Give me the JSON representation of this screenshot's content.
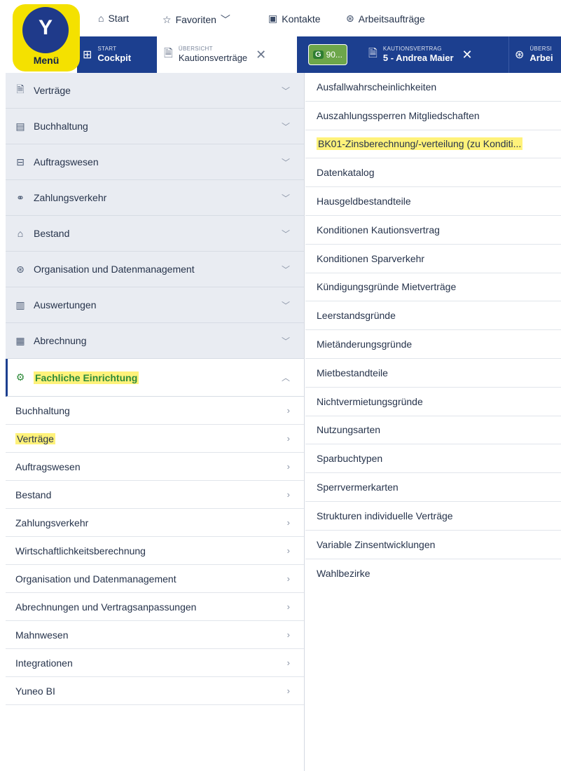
{
  "app": {
    "logo_letter": "Y",
    "menu_label": "Menü"
  },
  "topnav": [
    {
      "icon": "home-icon",
      "label": "Start"
    },
    {
      "icon": "star-icon",
      "label": "Favoriten"
    },
    {
      "icon": "contacts-icon",
      "label": "Kontakte"
    },
    {
      "icon": "tasks-icon",
      "label": "Arbeitsaufträge"
    }
  ],
  "tabs": [
    {
      "small": "START",
      "big": "Cockpit"
    },
    {
      "small": "ÜBERSICHT",
      "big": "Kautionsverträge",
      "active": true
    },
    {
      "badge_letter": "G",
      "badge_text": "90..."
    },
    {
      "small": "KAUTIONSVERTRAG",
      "big": "5 - Andrea Maier"
    },
    {
      "small": "ÜBERSI",
      "big": "Arbei"
    }
  ],
  "accordion": [
    {
      "icon": "contract-icon",
      "label": "Verträge"
    },
    {
      "icon": "ledger-icon",
      "label": "Buchhaltung"
    },
    {
      "icon": "order-icon",
      "label": "Auftragswesen"
    },
    {
      "icon": "payment-icon",
      "label": "Zahlungsverkehr"
    },
    {
      "icon": "building-icon",
      "label": "Bestand"
    },
    {
      "icon": "organization-icon",
      "label": "Organisation und Datenmanagement"
    },
    {
      "icon": "chart-icon",
      "label": "Auswertungen"
    },
    {
      "icon": "billing-icon",
      "label": "Abrechnung"
    },
    {
      "icon": "gear-icon",
      "label": "Fachliche Einrichtung"
    }
  ],
  "sub_items": [
    "Buchhaltung",
    "Verträge",
    "Auftragswesen",
    "Bestand",
    "Zahlungsverkehr",
    "Wirtschaftlichkeitsberechnung",
    "Organisation und Datenmanagement",
    "Abrechnungen und Vertragsanpassungen",
    "Mahnwesen",
    "Integrationen",
    "Yuneo BI"
  ],
  "right_items": [
    "Ausfallwahrscheinlichkeiten",
    "Auszahlungssperren Mitgliedschaften",
    "BK01-Zinsberechnung/-verteilung (zu Konditi...",
    "Datenkatalog",
    "Hausgeldbestandteile",
    "Konditionen Kautionsvertrag",
    "Konditionen Sparverkehr",
    "Kündigungsgründe Mietverträge",
    "Leerstandsgründe",
    "Mietänderungsgründe",
    "Mietbestandteile",
    "Nichtvermietungsgründe",
    "Nutzungsarten",
    "Sparbuchtypen",
    "Sperrvermerkarten",
    "Strukturen individuelle Verträge",
    "Variable Zinsentwicklungen",
    "Wahlbezirke"
  ],
  "colors": {
    "brand_blue": "#1c3f8f",
    "highlight": "#fff27a",
    "logo_yellow": "#f4e100",
    "active_green": "#2e8b3a"
  }
}
